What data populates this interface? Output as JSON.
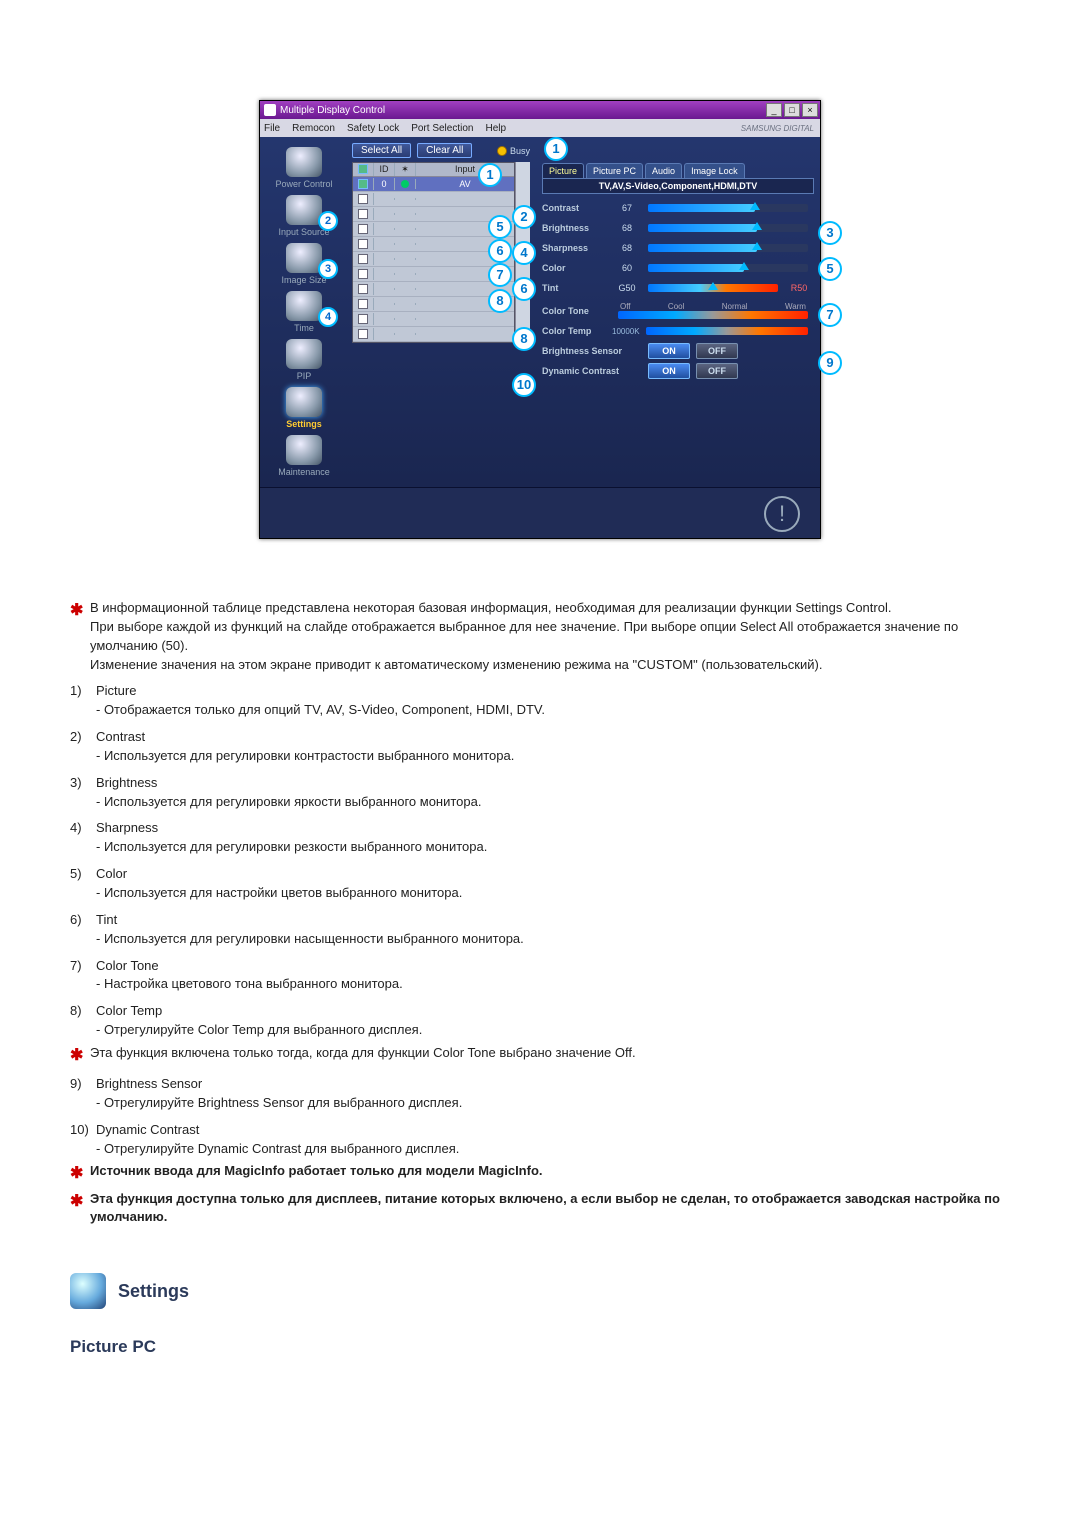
{
  "app": {
    "title": "Multiple Display Control",
    "menus": [
      "File",
      "Remocon",
      "Safety Lock",
      "Port Selection",
      "Help"
    ],
    "brand": "SAMSUNG DIGITAL",
    "buttons": {
      "select_all": "Select All",
      "clear_all": "Clear All",
      "busy": "Busy"
    },
    "nav": [
      {
        "label": "Power Control"
      },
      {
        "label": "Input Source",
        "badge": "2"
      },
      {
        "label": "Image Size",
        "badge": "3"
      },
      {
        "label": "Time",
        "badge": "4"
      },
      {
        "label": "PIP"
      },
      {
        "label": "Settings",
        "selected": true
      },
      {
        "label": "Maintenance"
      }
    ],
    "grid": {
      "headers": {
        "id": "ID",
        "input": "Input"
      },
      "rows": [
        {
          "id": "0",
          "input": "AV",
          "sel": true
        },
        {
          "input": "",
          "cb": "5"
        },
        {
          "input": "",
          "cb": "6"
        },
        {
          "input": "",
          "cb": "7"
        },
        {
          "input": "",
          "cb": "8"
        },
        {
          "input": ""
        },
        {
          "input": ""
        },
        {
          "input": ""
        },
        {
          "input": ""
        },
        {
          "input": ""
        },
        {
          "input": ""
        }
      ]
    },
    "tabs": [
      "Picture",
      "Picture PC",
      "Audio",
      "Image Lock"
    ],
    "sources": "TV,AV,S-Video,Component,HDMI,DTV",
    "sliders": {
      "contrast": {
        "label": "Contrast",
        "val": "67"
      },
      "brightness": {
        "label": "Brightness",
        "val": "68"
      },
      "sharpness": {
        "label": "Sharpness",
        "val": "68"
      },
      "color": {
        "label": "Color",
        "val": "60"
      },
      "tint": {
        "label": "Tint",
        "l": "G50",
        "r": "R50"
      }
    },
    "colortone": {
      "label": "Color Tone",
      "opts": [
        "Off",
        "Cool",
        "Normal",
        "Warm"
      ]
    },
    "colortemp": {
      "label": "Color Temp",
      "val": "10000K"
    },
    "bsensor": {
      "label": "Brightness Sensor",
      "on": "ON",
      "off": "OFF"
    },
    "dcontrast": {
      "label": "Dynamic Contrast",
      "on": "ON",
      "off": "OFF"
    }
  },
  "doc": {
    "intro": [
      "В информационной таблице представлена некоторая базовая информация, необходимая для реализации функции Settings Control.",
      "При выборе каждой из функций на слайде отображается выбранное для нее значение. При выборе опции Select All отображается значение по умолчанию (50).",
      "Изменение значения на этом экране приводит к автоматическому изменению режима на \"CUSTOM\" (пользовательский)."
    ],
    "items": {
      "1": {
        "t": "Picture",
        "d": "- Отображается только для опций TV, AV, S-Video, Component, HDMI, DTV."
      },
      "2": {
        "t": "Contrast",
        "d": "- Используется для регулировки контрастости выбранного монитора."
      },
      "3": {
        "t": "Brightness",
        "d": "- Используется для регулировки яркости выбранного монитора."
      },
      "4": {
        "t": "Sharpness",
        "d": "- Используется для регулировки резкости выбранного монитора."
      },
      "5": {
        "t": "Color",
        "d": "- Используется для настройки цветов выбранного монитора."
      },
      "6": {
        "t": "Tint",
        "d": "- Используется для регулировки насыщенности выбранного монитора."
      },
      "7": {
        "t": "Color Tone",
        "d": "- Настройка цветового тона выбранного монитора."
      },
      "8": {
        "t": "Color Temp",
        "d": "- Отрегулируйте Color Temp для выбранного дисплея."
      }
    },
    "star_after_8": "Эта функция включена только тогда, когда для функции Color Tone выбрано значение Off.",
    "items2": {
      "9": {
        "t": "Brightness Sensor",
        "d": "- Отрегулируйте Brightness Sensor для выбранного дисплея."
      },
      "10": {
        "t": "Dynamic Contrast",
        "d": "- Отрегулируйте Dynamic Contrast для выбранного дисплея."
      }
    },
    "foot_stars": [
      "Источник ввода для MagicInfo работает только для модели MagicInfo.",
      "Эта функция доступна только для дисплеев, питание которых включено, а если выбор не сделан, то отображается заводская настройка по умолчанию."
    ],
    "heading": "Settings",
    "subheading": "Picture PC"
  }
}
